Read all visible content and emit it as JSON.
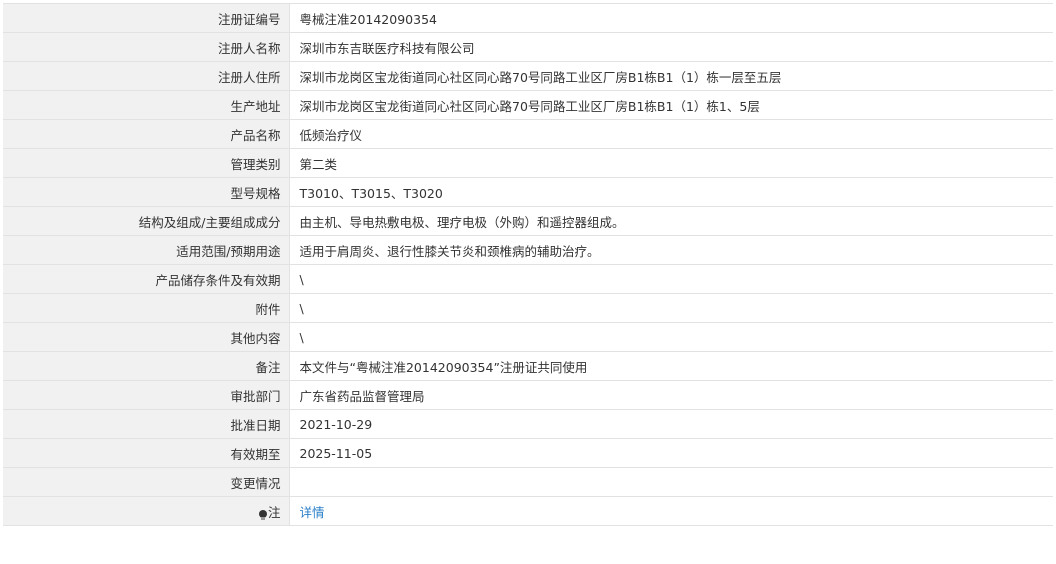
{
  "rows": [
    {
      "label": "注册证编号",
      "value": "粤械注准20142090354"
    },
    {
      "label": "注册人名称",
      "value": "深圳市东吉联医疗科技有限公司"
    },
    {
      "label": "注册人住所",
      "value": "深圳市龙岗区宝龙街道同心社区同心路70号同路工业区厂房B1栋B1（1）栋一层至五层"
    },
    {
      "label": "生产地址",
      "value": "深圳市龙岗区宝龙街道同心社区同心路70号同路工业区厂房B1栋B1（1）栋1、5层"
    },
    {
      "label": "产品名称",
      "value": "低频治疗仪"
    },
    {
      "label": "管理类别",
      "value": "第二类"
    },
    {
      "label": "型号规格",
      "value": "T3010、T3015、T3020"
    },
    {
      "label": "结构及组成/主要组成成分",
      "value": "由主机、导电热敷电极、理疗电极（外购）和遥控器组成。"
    },
    {
      "label": "适用范围/预期用途",
      "value": "适用于肩周炎、退行性膝关节炎和颈椎病的辅助治疗。"
    },
    {
      "label": "产品储存条件及有效期",
      "value": "\\"
    },
    {
      "label": "附件",
      "value": "\\"
    },
    {
      "label": "其他内容",
      "value": "\\"
    },
    {
      "label": "备注",
      "value": "本文件与“粤械注准20142090354”注册证共同使用"
    },
    {
      "label": "审批部门",
      "value": "广东省药品监督管理局"
    },
    {
      "label": "批准日期",
      "value": "2021-10-29"
    },
    {
      "label": "有效期至",
      "value": "2025-11-05"
    },
    {
      "label": "变更情况",
      "value": ""
    }
  ],
  "note": {
    "icon": "lightbulb-icon",
    "label": "注",
    "link_text": "详情",
    "link_color": "#2a7fc9"
  },
  "colors": {
    "label_bg": "#f1f1f1",
    "border": "#e2e2e2",
    "text": "#333333"
  }
}
